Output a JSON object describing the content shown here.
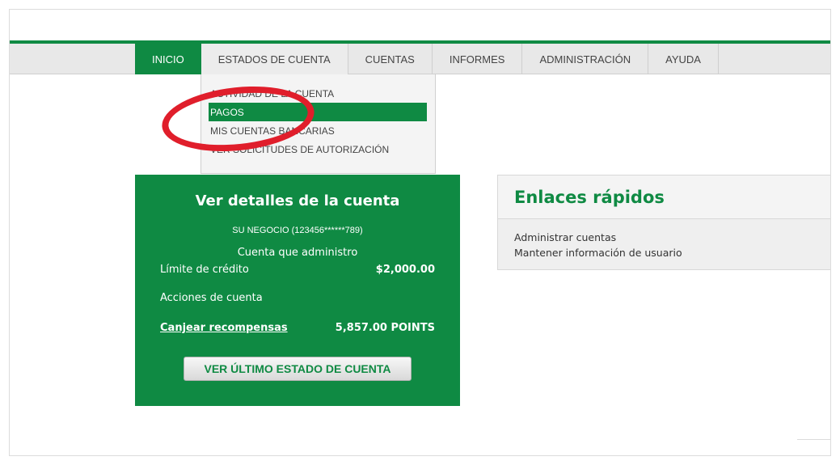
{
  "nav": {
    "tabs": [
      {
        "label": "INICIO"
      },
      {
        "label": "ESTADOS DE CUENTA"
      },
      {
        "label": "CUENTAS"
      },
      {
        "label": "INFORMES"
      },
      {
        "label": "ADMINISTRACIÓN"
      },
      {
        "label": "AYUDA"
      }
    ],
    "active_tab": "INICIO",
    "open_tab": "ESTADOS DE CUENTA"
  },
  "dropdown": {
    "items": [
      {
        "label": "ACTIVIDAD DE LA CUENTA"
      },
      {
        "label": "PAGOS"
      },
      {
        "label": "MIS CUENTAS BANCARIAS"
      },
      {
        "label": "VER SOLICITUDES DE AUTORIZACIÓN"
      }
    ],
    "selected": "PAGOS"
  },
  "account_panel": {
    "title": "Ver detalles de la cuenta",
    "account_name": "SU NEGOCIO (123456******789)",
    "role": "Cuenta que administro",
    "credit_limit_label": "Límite de crédito",
    "credit_limit_value": "$2,000.00",
    "actions_label": "Acciones de cuenta",
    "rewards_link": "Canjear recompensas",
    "points_value": "5,857.00 POINTS",
    "statement_button": "VER ÚLTIMO ESTADO DE CUENTA"
  },
  "quick_links": {
    "title": "Enlaces rápidos",
    "items": [
      {
        "label": "Administrar cuentas"
      },
      {
        "label": "Mantener información de usuario"
      }
    ]
  },
  "colors": {
    "brand_green": "#0f8a43",
    "annotation_red": "#e01e2b",
    "nav_gray": "#e8e8e8"
  }
}
